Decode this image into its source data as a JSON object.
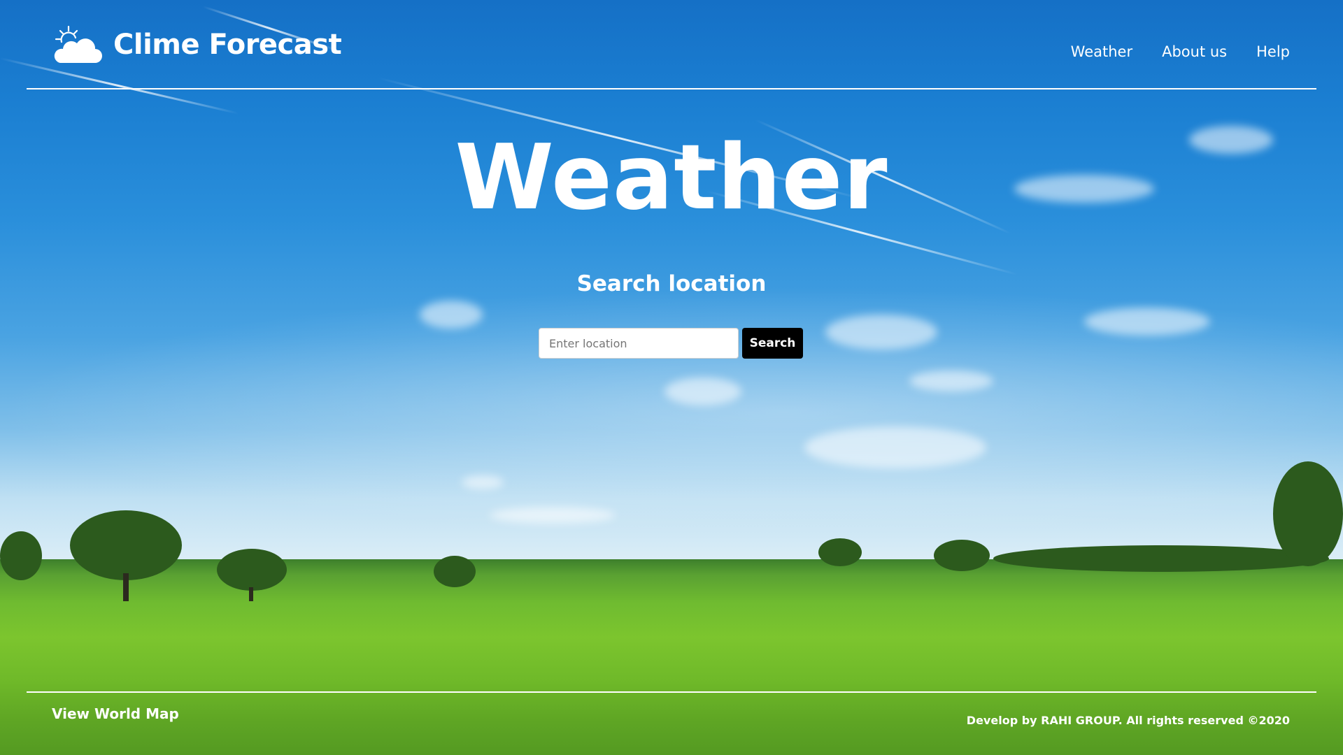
{
  "header": {
    "brand_name": "Clime Forecast",
    "brand_icon": "sun-cloud-icon",
    "nav": [
      {
        "label": "Weather"
      },
      {
        "label": "About us"
      },
      {
        "label": "Help"
      }
    ]
  },
  "hero": {
    "title": "Weather",
    "search_title": "Search location",
    "search_placeholder": "Enter location",
    "search_value": "",
    "search_button": "Search"
  },
  "footer": {
    "map_link": "View World Map",
    "copyright": "Develop by RAHI GROUP. All rights reserved ©2020"
  },
  "colors": {
    "text": "#ffffff",
    "button_bg": "#000000",
    "sky": "#1b7fd2",
    "grass": "#6fbb30"
  }
}
